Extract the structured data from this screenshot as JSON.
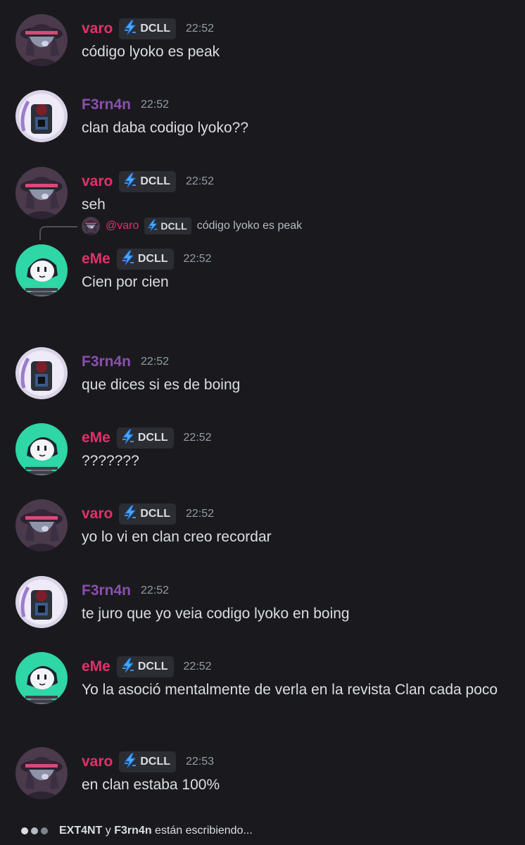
{
  "colors": {
    "varo": "#e2306c",
    "F3rn4n": "#8a4fb0",
    "eMe": "#e2306c"
  },
  "tag_label": "DCLL",
  "tag_icon": "lightning-bolt-icon",
  "messages": [
    {
      "author": "varo",
      "avatar": "varo",
      "has_tag": true,
      "time": "22:52",
      "text": "código lyoko es peak"
    },
    {
      "author": "F3rn4n",
      "avatar": "f3rn4n",
      "has_tag": false,
      "time": "22:52",
      "text": "clan daba codigo lyoko??"
    },
    {
      "author": "varo",
      "avatar": "varo",
      "has_tag": true,
      "time": "22:52",
      "text": "seh"
    },
    {
      "author": "eMe",
      "avatar": "eme",
      "has_tag": true,
      "time": "22:52",
      "text": "Cien por cien",
      "reply": {
        "name": "@varo",
        "tag": "DCLL",
        "text": "código lyoko es peak"
      }
    },
    {
      "author": "F3rn4n",
      "avatar": "f3rn4n",
      "has_tag": false,
      "time": "22:52",
      "text": "que dices si es de boing"
    },
    {
      "author": "eMe",
      "avatar": "eme",
      "has_tag": true,
      "time": "22:52",
      "text": "???????"
    },
    {
      "author": "varo",
      "avatar": "varo",
      "has_tag": true,
      "time": "22:52",
      "text": "yo lo vi en clan creo recordar"
    },
    {
      "author": "F3rn4n",
      "avatar": "f3rn4n",
      "has_tag": false,
      "time": "22:52",
      "text": "te juro que yo veia codigo lyoko en boing"
    },
    {
      "author": "eMe",
      "avatar": "eme",
      "has_tag": true,
      "time": "22:52",
      "text": "Yo la asoció mentalmente de verla en la revista Clan cada poco"
    },
    {
      "author": "varo",
      "avatar": "varo",
      "has_tag": true,
      "time": "22:53",
      "text": "en clan estaba 100%"
    }
  ],
  "typing": {
    "user1": "EXT4NT",
    "connector": "y",
    "user2": "F3rn4n",
    "suffix": "están escribiendo..."
  }
}
